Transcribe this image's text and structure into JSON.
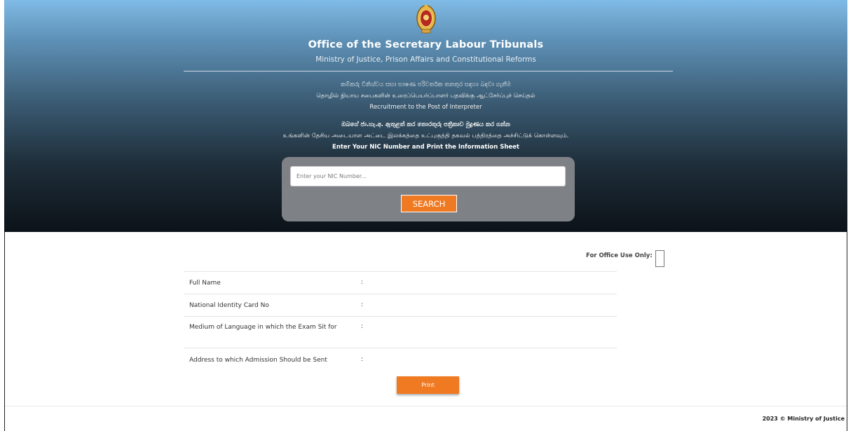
{
  "header": {
    "title": "Office of the Secretary Labour Tribunals",
    "subtitle": "Ministry of Justice, Prison Affairs and Constitutional Reforms",
    "sinhala_line": "කම්කරු විනිශ්චය සභා භාෂණ පරිවර්තක තනතුර සඳහා බඳවා ගැනීම",
    "tamil_line": "தொழில் நியாய சபைகளின் உரைப்பெயர்ப்பாளர் பதவிக்கு ஆட்சேர்ப்புச் செய்தல்",
    "english_line": "Recruitment to the Post of Interpreter",
    "instruction_sinhala": "ඔබගේ ජා.හැ.අ. ඇතුළත් කර තොරතුරු පත්‍රිකාව මුද්‍රණය කර ගන්න",
    "instruction_tamil": "உங்களின் தேசிய அடையாள அட்டை இலக்கத்தை உட்புகுத்தி தகவல் பத்திரத்தை அச்சிட்டுக் கொள்ளவும்.",
    "instruction_english": "Enter Your NIC Number and Print the Information Sheet"
  },
  "search": {
    "placeholder": "Enter your NIC Number...",
    "button_label": "SEARCH"
  },
  "office_use_label": "For Office Use Only:",
  "details": [
    {
      "label": "Full Name",
      "value": ":"
    },
    {
      "label": "National Identity Card No",
      "value": ":"
    },
    {
      "label": "Medium of Language in which the Exam Sit for",
      "value": ":"
    },
    {
      "label": "Address to which Admission Should be Sent",
      "value": ":"
    }
  ],
  "print_label": "Print",
  "footer": {
    "copyright": "2023 © Ministry of Justice"
  },
  "colors": {
    "accent": "#f07a22"
  }
}
